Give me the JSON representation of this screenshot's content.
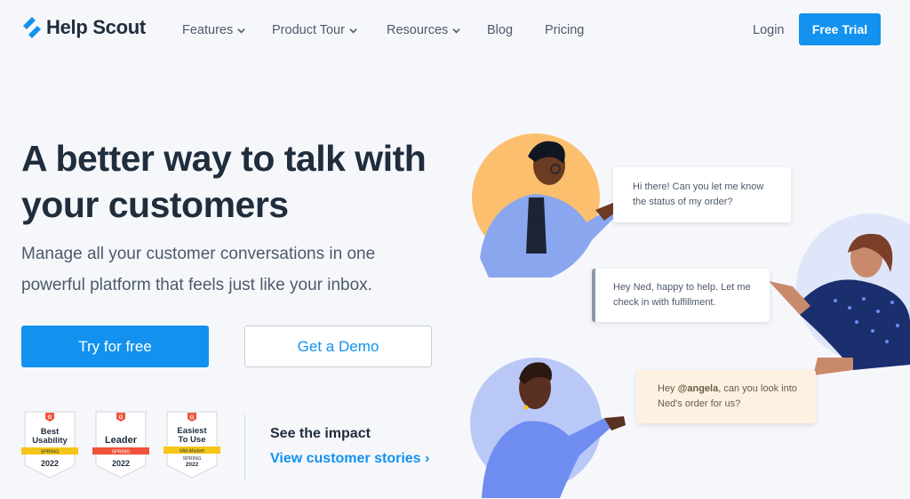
{
  "brand": {
    "name": "Help Scout",
    "logo_color": "#1292ee"
  },
  "nav": {
    "items": [
      {
        "label": "Features",
        "has_dropdown": true
      },
      {
        "label": "Product Tour",
        "has_dropdown": true
      },
      {
        "label": "Resources",
        "has_dropdown": true
      },
      {
        "label": "Blog",
        "has_dropdown": false
      },
      {
        "label": "Pricing",
        "has_dropdown": false
      }
    ],
    "login": "Login",
    "free_trial": "Free Trial"
  },
  "hero": {
    "headline": "A better way to talk with your customers",
    "subhead": "Manage all your customer conversations in one powerful platform that feels just like your inbox.",
    "primary_cta": "Try for free",
    "secondary_cta": "Get a Demo"
  },
  "badges": [
    {
      "title_line1": "Best",
      "title_line2": "Usability",
      "ribbon": "SPRING",
      "ribbon_color": "#f5c518",
      "year": "2022"
    },
    {
      "title_line1": "Leader",
      "title_line2": "",
      "ribbon": "SPRING",
      "ribbon_color": "#f0533a",
      "year": "2022"
    },
    {
      "title_line1": "Easiest",
      "title_line2": "To Use",
      "ribbon": "Mid-Market",
      "ribbon_color": "#f5c518",
      "season": "SPRING",
      "year": "2022"
    }
  ],
  "impact": {
    "title": "See the impact",
    "link": "View customer stories ›"
  },
  "chat": {
    "bubble1": "Hi there! Can you let me know the status of my order?",
    "bubble2": "Hey Ned, happy to help. Let me check in with fulfillment.",
    "bubble3_prefix": "Hey ",
    "bubble3_mention": "@angela",
    "bubble3_suffix": ", can you look into Ned's order for us?"
  },
  "colors": {
    "accent": "#1292ee",
    "heading": "#1f2d3d",
    "body": "#4c5a6b",
    "background": "#f6f7fb"
  }
}
